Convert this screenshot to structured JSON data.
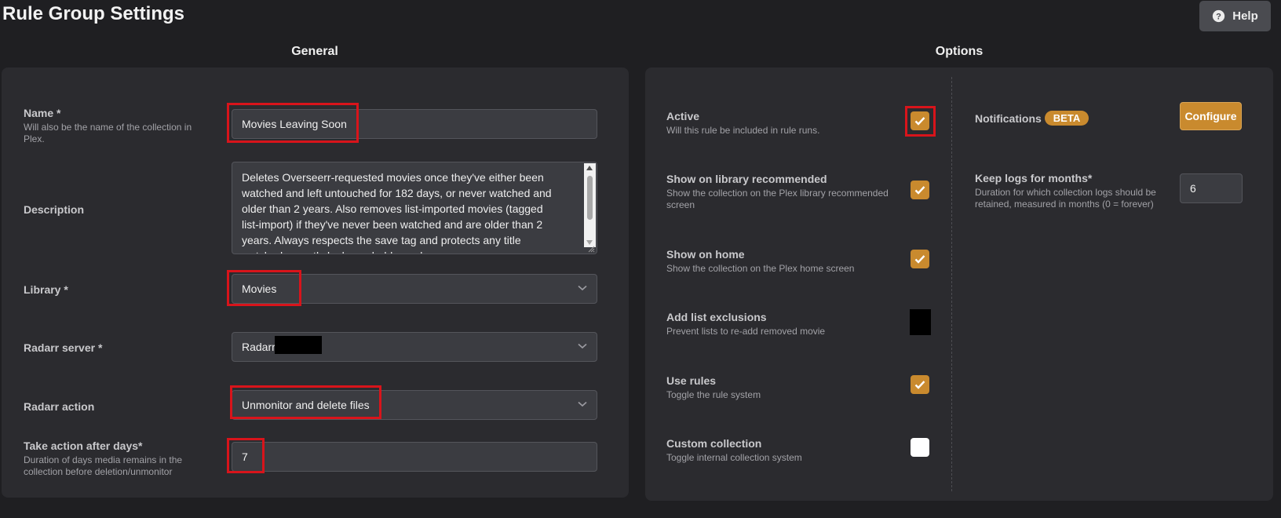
{
  "header": {
    "title": "Rule Group Settings",
    "help_label": "Help"
  },
  "general": {
    "heading": "General",
    "name": {
      "label": "Name *",
      "description": "Will also be the name of the collection in Plex.",
      "value": "Movies Leaving Soon"
    },
    "description": {
      "label": "Description",
      "value": "Deletes Overseerr-requested movies once they've either been watched and left untouched for 182 days, or never watched and older than 2 years. Also removes list-imported movies (tagged list-import) if they've never been watched and are older than 2 years. Always respects the save tag and protects any title watched recently by household members."
    },
    "library": {
      "label": "Library *",
      "value": "Movies"
    },
    "radarr_server": {
      "label": "Radarr server *",
      "value": "Radarr"
    },
    "radarr_action": {
      "label": "Radarr action",
      "value": "Unmonitor and delete files"
    },
    "take_action": {
      "label": "Take action after days*",
      "description": "Duration of days media remains in the collection before deletion/unmonitor",
      "value": "7"
    }
  },
  "options": {
    "heading": "Options",
    "items": [
      {
        "label": "Active",
        "description": "Will this rule be included in rule runs.",
        "checked": true
      },
      {
        "label": "Show on library recommended",
        "description": "Show the collection on the Plex library recommended screen",
        "checked": true
      },
      {
        "label": "Show on home",
        "description": "Show the collection on the Plex home screen",
        "checked": true
      },
      {
        "label": "Add list exclusions",
        "description": "Prevent lists to re-add removed movie",
        "checked": null
      },
      {
        "label": "Use rules",
        "description": "Toggle the rule system",
        "checked": true
      },
      {
        "label": "Custom collection",
        "description": "Toggle internal collection system",
        "checked": false
      }
    ],
    "notifications": {
      "label": "Notifications",
      "badge": "BETA",
      "configure_label": "Configure"
    },
    "keep_logs": {
      "label": "Keep logs for months*",
      "description": "Duration for which collection logs should be retained, measured in months (0 = forever)",
      "value": "6"
    }
  },
  "colors": {
    "accent": "#c98a2e",
    "highlight_box": "#d8141b",
    "background": "#1f1f22",
    "card": "#2b2b2f",
    "input": "#3b3c41"
  }
}
